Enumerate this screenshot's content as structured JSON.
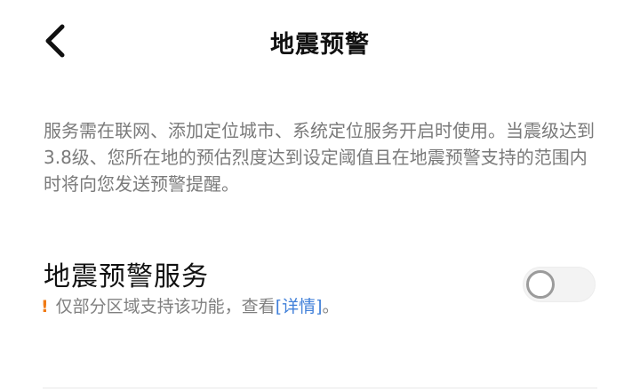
{
  "header": {
    "back_icon": "chevron-left-icon",
    "title": "地震预警"
  },
  "description": "服务需在联网、添加定位城市、系统定位服务开启时使用。当震级达到3.8级、您所在地的预估烈度达到设定阈值且在地震预警支持的范围内时将向您发送预警提醒。",
  "service": {
    "title": "地震预警服务",
    "warning_mark": "!",
    "note_prefix": "仅部分区域支持该功能，查看",
    "note_link": "[详情]",
    "note_suffix": "。",
    "toggle_state": "off"
  },
  "colors": {
    "warning": "#f07b16",
    "link": "#3f7fd9"
  }
}
